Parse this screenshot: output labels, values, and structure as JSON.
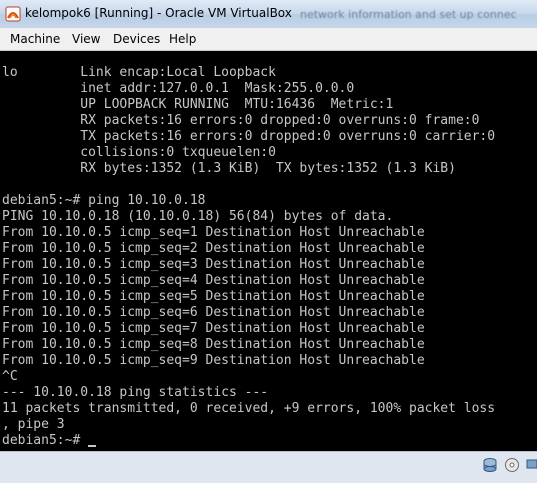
{
  "window": {
    "title": "kelompok6 [Running] - Oracle VM VirtualBox",
    "background_text": "network information and set up connec"
  },
  "menu": {
    "items": [
      "Machine",
      "View",
      "Devices",
      "Help"
    ]
  },
  "terminal": {
    "lines": [
      "lo        Link encap:Local Loopback",
      "          inet addr:127.0.0.1  Mask:255.0.0.0",
      "          UP LOOPBACK RUNNING  MTU:16436  Metric:1",
      "          RX packets:16 errors:0 dropped:0 overruns:0 frame:0",
      "          TX packets:16 errors:0 dropped:0 overruns:0 carrier:0",
      "          collisions:0 txqueuelen:0",
      "          RX bytes:1352 (1.3 KiB)  TX bytes:1352 (1.3 KiB)",
      "",
      "debian5:~# ping 10.10.0.18",
      "PING 10.10.0.18 (10.10.0.18) 56(84) bytes of data.",
      "From 10.10.0.5 icmp_seq=1 Destination Host Unreachable",
      "From 10.10.0.5 icmp_seq=2 Destination Host Unreachable",
      "From 10.10.0.5 icmp_seq=3 Destination Host Unreachable",
      "From 10.10.0.5 icmp_seq=4 Destination Host Unreachable",
      "From 10.10.0.5 icmp_seq=5 Destination Host Unreachable",
      "From 10.10.0.5 icmp_seq=6 Destination Host Unreachable",
      "From 10.10.0.5 icmp_seq=7 Destination Host Unreachable",
      "From 10.10.0.5 icmp_seq=8 Destination Host Unreachable",
      "From 10.10.0.5 icmp_seq=9 Destination Host Unreachable",
      "^C",
      "--- 10.10.0.18 ping statistics ---",
      "11 packets transmitted, 0 received, +9 errors, 100% packet loss",
      ", pipe 3"
    ],
    "prompt": "debian5:~# ",
    "text_color": "#c7c7c7",
    "background_color": "#000000"
  },
  "statusbar": {
    "icons": [
      "hard-disk-icon",
      "optical-drive-icon",
      "network-icon"
    ]
  }
}
